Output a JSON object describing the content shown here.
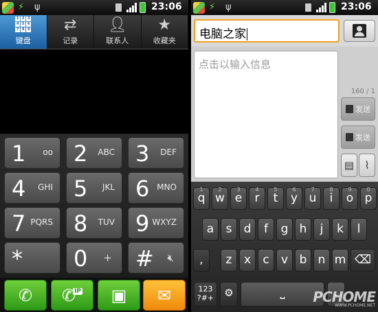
{
  "status_bar": {
    "time": "23:06"
  },
  "dialer": {
    "tabs": [
      {
        "label": "键盘",
        "icon": "keypad-icon",
        "active": true
      },
      {
        "label": "记录",
        "icon": "call-log-icon",
        "active": false
      },
      {
        "label": "联系人",
        "icon": "person-icon",
        "active": false
      },
      {
        "label": "收藏夹",
        "icon": "star-icon",
        "active": false
      }
    ],
    "keys": [
      {
        "digit": "1",
        "sub": "oo",
        "sub_icon": "voicemail-icon"
      },
      {
        "digit": "2",
        "sub": "ABC"
      },
      {
        "digit": "3",
        "sub": "DEF"
      },
      {
        "digit": "4",
        "sub": "GHI"
      },
      {
        "digit": "5",
        "sub": "JKL"
      },
      {
        "digit": "6",
        "sub": "MNO"
      },
      {
        "digit": "7",
        "sub": "PQRS"
      },
      {
        "digit": "8",
        "sub": "TUV"
      },
      {
        "digit": "9",
        "sub": "WXYZ"
      },
      {
        "digit": "*",
        "sub": ""
      },
      {
        "digit": "0",
        "sub": "+"
      },
      {
        "digit": "#",
        "sub": "",
        "sub_icon": "mute-icon"
      }
    ],
    "actions": [
      {
        "name": "call-button",
        "icon": "phone-icon",
        "color": "#3aa61e"
      },
      {
        "name": "ip-call-button",
        "icon": "ip-phone-icon",
        "label": "IP",
        "color": "#3aa61e"
      },
      {
        "name": "contacts-button",
        "icon": "contact-card-icon",
        "color": "#3aa61e"
      },
      {
        "name": "sms-button",
        "icon": "envelope-icon",
        "color": "#f29a1b"
      }
    ]
  },
  "compose": {
    "recipient": "电脑之家",
    "message_placeholder": "点击以输入信息",
    "char_count": "160 / 1",
    "send_label_1": "发送",
    "send_label_2": "发送"
  },
  "keyboard": {
    "row1": [
      "q",
      "w",
      "e",
      "r",
      "t",
      "y",
      "u",
      "i",
      "o",
      "p"
    ],
    "row1_hints": [
      "1",
      "2",
      "3",
      "4",
      "5",
      "6",
      "7",
      "8",
      "9",
      "0"
    ],
    "row2": [
      "a",
      "s",
      "d",
      "f",
      "g",
      "h",
      "j",
      "k",
      "l"
    ],
    "row3": [
      "z",
      "x",
      "c",
      "v",
      "b",
      "n",
      "m"
    ],
    "comma": ",",
    "period": ".",
    "symbols_label": "123\n?#+",
    "space_label": "⎵"
  },
  "watermark": {
    "main": "PCHOME",
    "sub": "WWW.PCHOME.NET"
  },
  "colors": {
    "tab_active": "#2e7cc4",
    "focus_orange": "#f2a020",
    "call_green": "#3aa61e",
    "sms_orange": "#f29a1b"
  }
}
